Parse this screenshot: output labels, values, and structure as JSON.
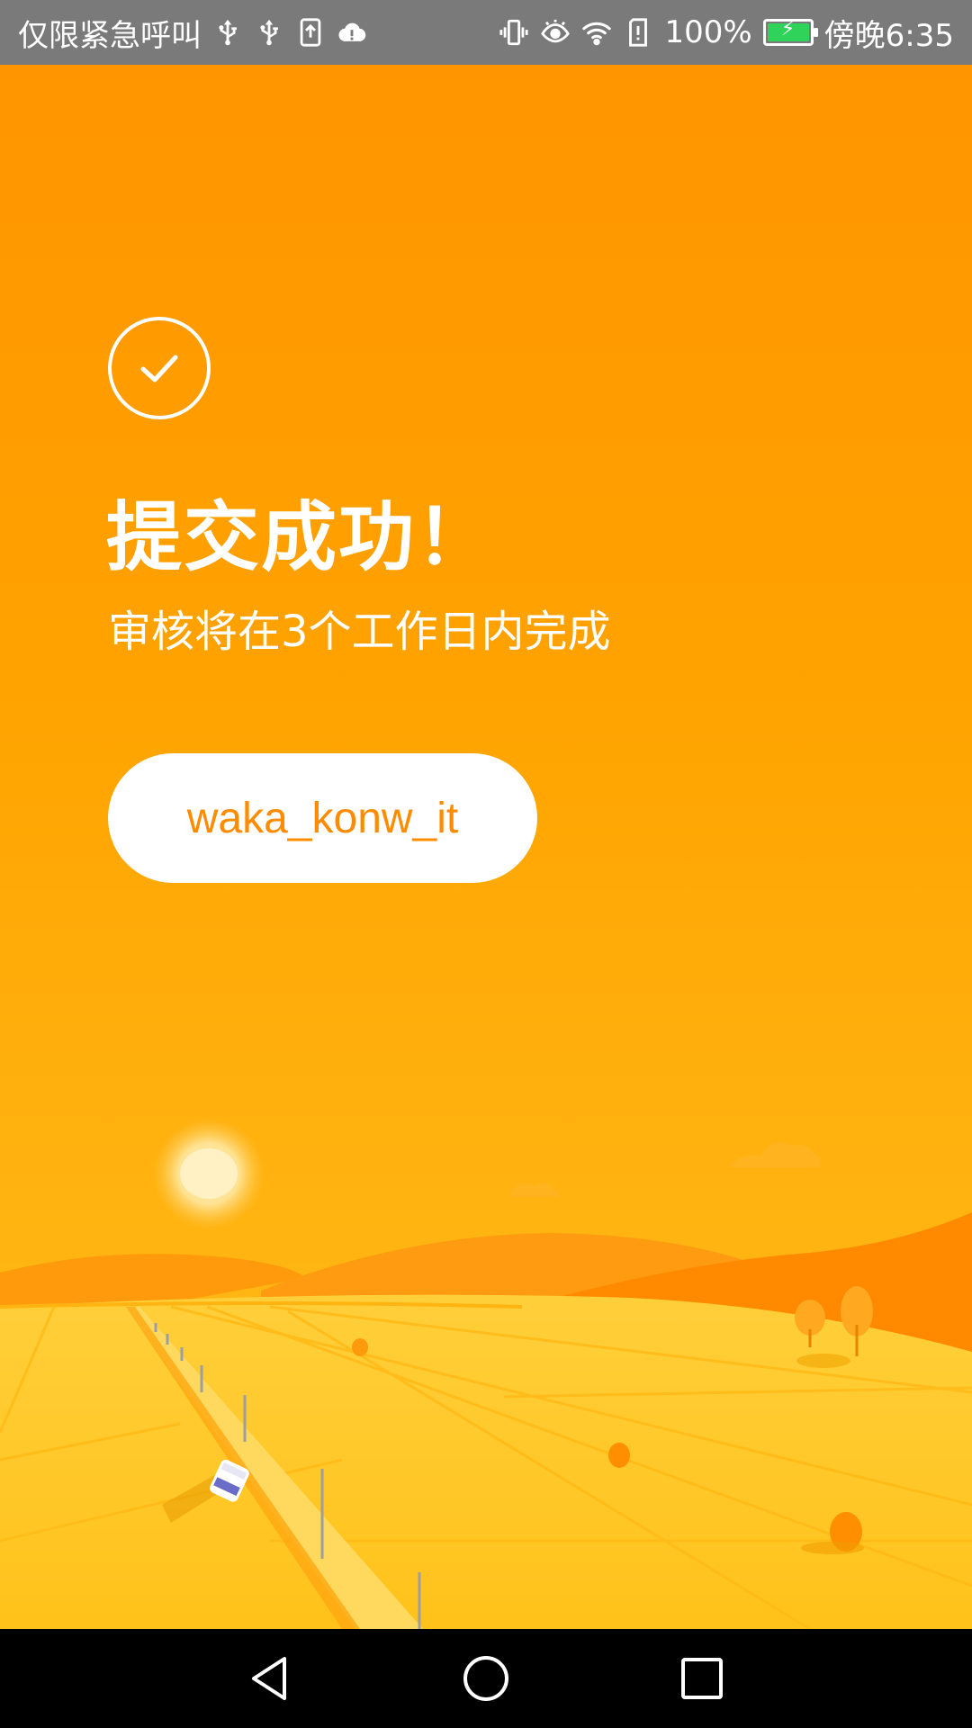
{
  "status_bar": {
    "carrier_text": "仅限紧急呼叫",
    "battery_percent": "100%",
    "battery_level": 1.0,
    "time": "傍晚6:35",
    "left_icons": [
      "usb-icon",
      "usb-icon",
      "upload-icon",
      "cloud-alert-icon"
    ],
    "right_icons": [
      "vibrate-icon",
      "eye-icon",
      "wifi-icon",
      "sim-alert-icon",
      "battery-charging-icon"
    ]
  },
  "main": {
    "check_icon": "check-circle-icon",
    "title": "提交成功！",
    "subtitle": "审核将在3个工作日内完成",
    "button_label": "waka_konw_it"
  },
  "nav_bar": {
    "buttons": [
      "back-icon",
      "home-icon",
      "recents-icon"
    ]
  },
  "colors": {
    "background_top": "#ff9500",
    "background_bottom": "#ffbe1a",
    "button_text": "#ff8c00",
    "status_bar": "#7a7a7a"
  }
}
